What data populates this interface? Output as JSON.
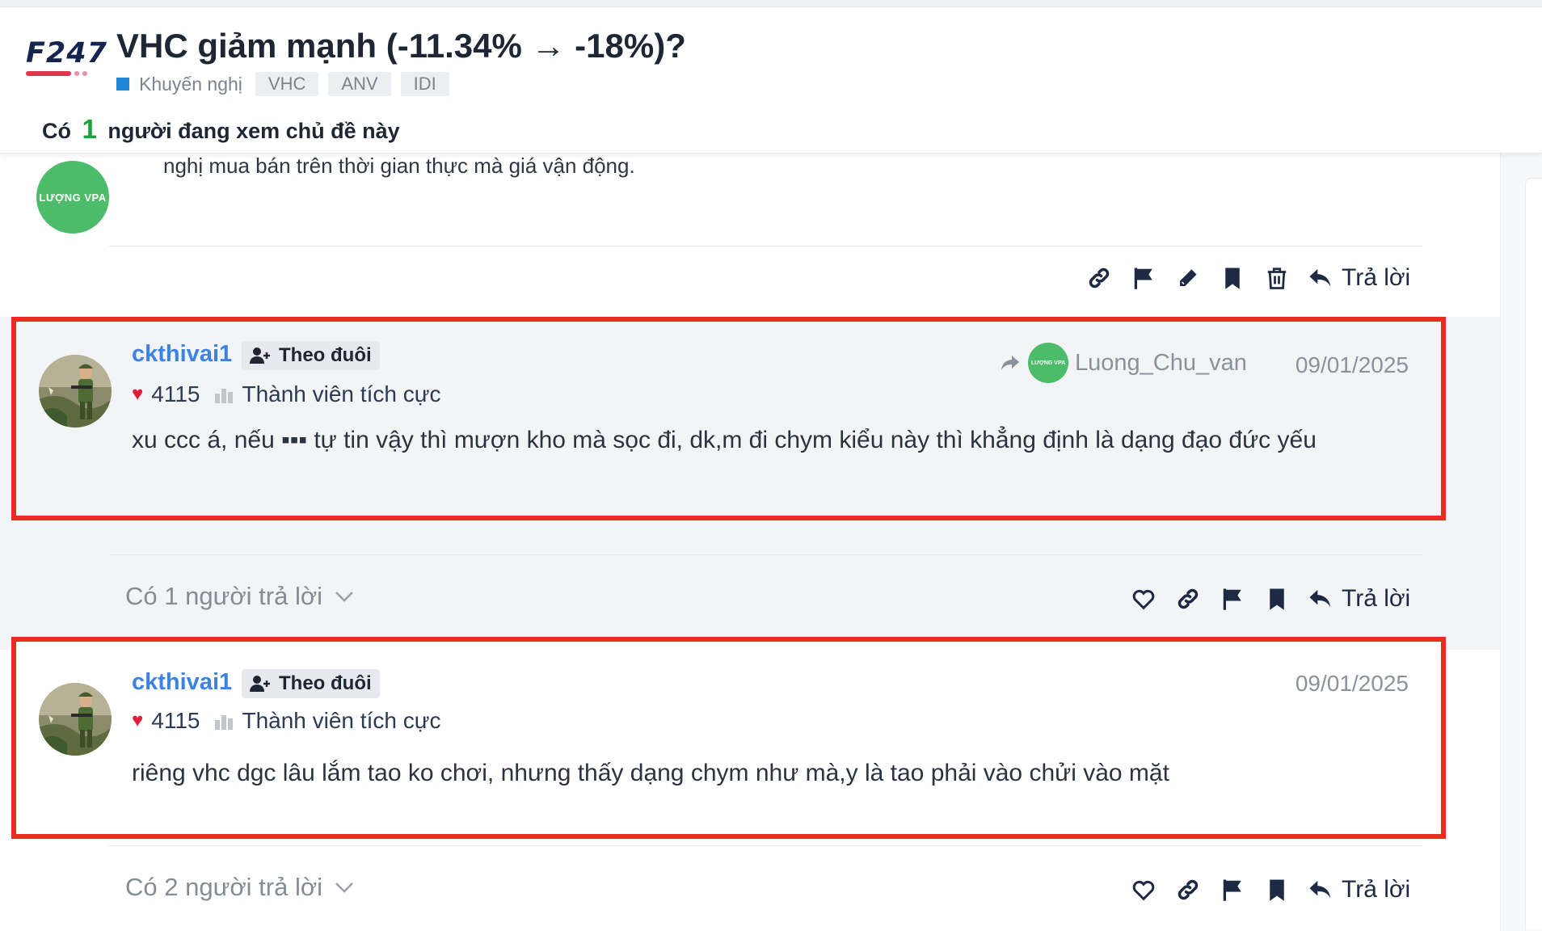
{
  "header": {
    "logo_text": "F247",
    "title": "VHC giảm mạnh (-11.34% → -18%)?",
    "category": "Khuyến nghị",
    "tags": [
      "VHC",
      "ANV",
      "IDI"
    ],
    "viewers_prefix": "Có",
    "viewers_count": "1",
    "viewers_suffix": "người đang xem chủ đề này"
  },
  "prev_post": {
    "avatar_text": "LƯỢNG VPA",
    "text_fragment": "nghị mua bán trên thời gian thực mà giá vận động.",
    "reply_label": "Trả lời"
  },
  "posts": [
    {
      "username": "ckthivai1",
      "follow_label": "Theo đuôi",
      "likes": "4115",
      "rank": "Thành viên tích cực",
      "reply_to": "Luong_Chu_van",
      "reply_to_avatar_text": "LƯỢNG VPA",
      "date": "09/01/2025",
      "content": "xu ccc á, nếu ▪▪▪ tự tin vậy thì mượn kho mà sọc đi, dk,m đi chym kiểu này thì khẳng định là dạng đạo đức yếu",
      "replies_label": "Có 1 người trả lời",
      "reply_label": "Trả lời"
    },
    {
      "username": "ckthivai1",
      "follow_label": "Theo đuôi",
      "likes": "4115",
      "rank": "Thành viên tích cực",
      "date": "09/01/2025",
      "content": "riêng vhc dgc lâu lắm tao ko chơi, nhưng thấy dạng chym như mà,y là tao phải vào chửi vào mặt",
      "replies_label": "Có 2 người trả lời",
      "reply_label": "Trả lời"
    }
  ],
  "colors": {
    "accent_link": "#3b82e6",
    "highlight_border": "#ea2b1f",
    "viewer_count": "#1ba13b",
    "heart": "#e11d3a",
    "category": "#1e88d6",
    "avatar_green": "#4cbb6a"
  },
  "icons": [
    "link-icon",
    "flag-icon",
    "edit-icon",
    "bookmark-icon",
    "trash-icon",
    "reply-icon",
    "heart-icon",
    "follow-user-icon",
    "share-arrow-icon",
    "chevron-down-icon"
  ]
}
